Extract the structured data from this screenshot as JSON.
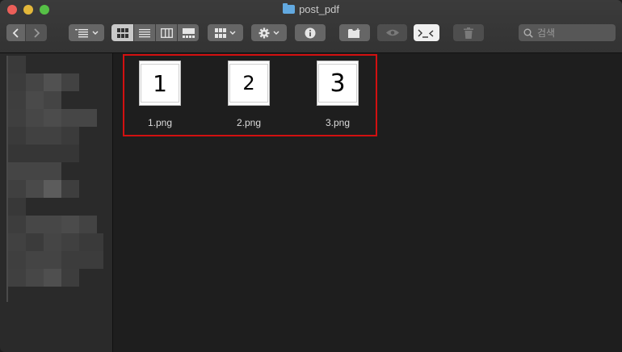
{
  "window": {
    "title": "post_pdf"
  },
  "toolbar": {
    "back_icon": "chevron-left-icon",
    "forward_icon": "chevron-right-icon",
    "group_icon": "list-group-icon",
    "view_icons": [
      "grid-view-icon",
      "list-view-icon",
      "column-view-icon",
      "gallery-view-icon"
    ],
    "arrange_icon": "arrange-icon",
    "action_icon": "gear-icon",
    "info_icon": "info-icon",
    "new_folder_icon": "new-folder-icon",
    "preview_icon": "eye-icon",
    "terminal_icon": "terminal-icon",
    "trash_icon": "trash-icon",
    "search_placeholder": "검색"
  },
  "files": [
    {
      "name": "1.png",
      "thumb_text": "1"
    },
    {
      "name": "2.png",
      "thumb_text": "2"
    },
    {
      "name": "3.png",
      "thumb_text": "3"
    }
  ],
  "colors": {
    "selection_box": "#d21010",
    "folder_icon": "#62a9e0"
  }
}
